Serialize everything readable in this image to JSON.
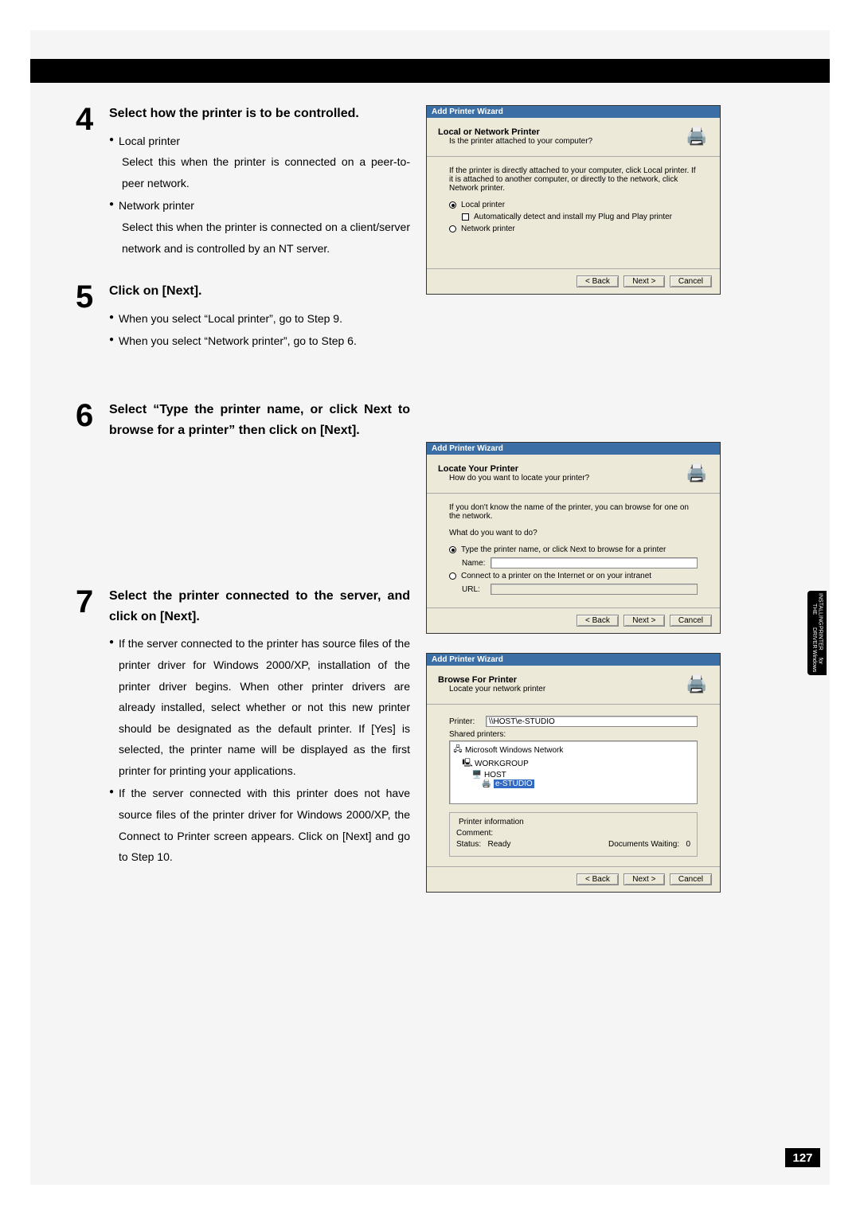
{
  "page_number": "127",
  "side_tab": {
    "line1": "INSTALLING THE",
    "line2": "PRINTER DRIVER",
    "line3": "for Windows"
  },
  "steps": [
    {
      "num": "4",
      "title": "Select how the printer is to be controlled.",
      "items": [
        {
          "lead": "Local printer",
          "body": "Select this when the printer is connected on a peer-to-peer network."
        },
        {
          "lead": "Network printer",
          "body": "Select this when the printer is connected on a client/server network and is controlled by an NT server."
        }
      ]
    },
    {
      "num": "5",
      "title": "Click on [Next].",
      "items": [
        {
          "lead": "When you select “Local printer”, go to Step 9."
        },
        {
          "lead": "When you select “Network printer”, go to Step 6."
        }
      ]
    },
    {
      "num": "6",
      "title": "Select “Type the printer name, or click Next to browse for a printer” then click on [Next].",
      "items": []
    },
    {
      "num": "7",
      "title": "Select the printer connected to the server, and click on [Next].",
      "items": [
        {
          "lead": "If the server connected to the printer has source files of the printer driver for Windows 2000/XP, installation of the printer driver begins.  When other printer drivers are already installed, select whether or not this new printer should be designated as the default printer.  If [Yes] is selected, the printer name will be displayed as the first printer for printing your applications."
        },
        {
          "lead": "If the server connected with this printer does not have source files of the printer driver for Windows 2000/XP, the Connect to Printer screen appears.  Click on [Next] and go to Step 10."
        }
      ]
    }
  ],
  "dialog1": {
    "title": "Add Printer Wizard",
    "header": "Local or Network Printer",
    "subheader": "Is the printer attached to your computer?",
    "instruction": "If the printer is directly attached to your computer, click Local printer.  If it is attached to another computer, or directly to the network, click Network printer.",
    "opt_local": "Local printer",
    "check_auto": "Automatically detect and install my Plug and Play printer",
    "opt_network": "Network printer",
    "back": "< Back",
    "next": "Next >",
    "cancel": "Cancel"
  },
  "dialog2": {
    "title": "Add Printer Wizard",
    "header": "Locate Your Printer",
    "subheader": "How do you want to locate your printer?",
    "instruction": "If you don't know the name of the printer, you can browse for one on the network.",
    "prompt": "What do you want to do?",
    "opt_type": "Type the printer name, or click Next to browse for a printer",
    "name_lbl": "Name:",
    "opt_url": "Connect to a printer on the Internet or on your intranet",
    "url_lbl": "URL:",
    "back": "< Back",
    "next": "Next >",
    "cancel": "Cancel"
  },
  "dialog3": {
    "title": "Add Printer Wizard",
    "header": "Browse For Printer",
    "subheader": "Locate your network printer",
    "printer_lbl": "Printer:",
    "printer_val": "\\\\HOST\\e-STUDIO",
    "shared_lbl": "Shared printers:",
    "tree": {
      "root": "Microsoft Windows Network",
      "group": "WORKGROUP",
      "host": "HOST",
      "printer": "e-STUDIO"
    },
    "info_title": "Printer information",
    "comment_lbl": "Comment:",
    "status_lbl": "Status:",
    "status_val": "Ready",
    "docs_lbl": "Documents Waiting:",
    "docs_val": "0",
    "back": "< Back",
    "next": "Next >",
    "cancel": "Cancel"
  }
}
